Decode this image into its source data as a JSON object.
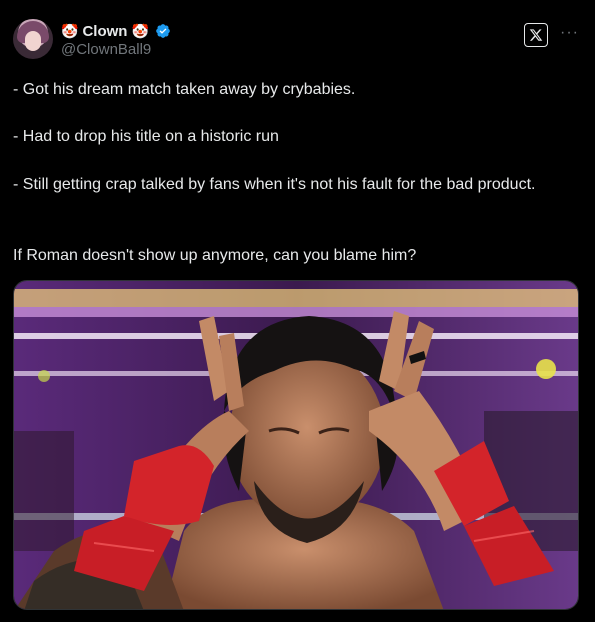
{
  "author": {
    "display_name": "Clown",
    "handle": "@ClownBall9",
    "name_prefix_emoji": "clown-face-icon",
    "name_suffix_emoji": "clown-face-icon",
    "verified": true,
    "verified_color": "#1d9bf0"
  },
  "header_icons": {
    "platform_logo": "x-logo-icon",
    "more": "more-options-icon"
  },
  "tweet": {
    "lines": [
      "- Got his dream match taken away by crybabies.",
      "- Had to drop his title on a historic run",
      "- Still getting crap talked by fans when it's not his fault for the bad product.",
      "If Roman doesn't show up anymore, can you blame him?"
    ]
  },
  "media": {
    "type": "photo",
    "subject": "wrestler-photo"
  },
  "colors": {
    "background": "#000000",
    "text": "#e7e9ea",
    "secondary_text": "#71767b"
  }
}
